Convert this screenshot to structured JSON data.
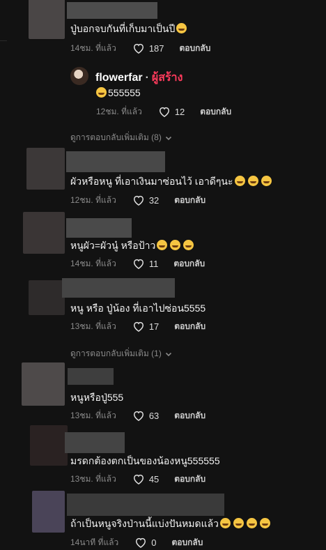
{
  "comments": [
    {
      "text": "ปู่บอกจบกันที่เก็บมาเป็นปี",
      "time": "14ชม. ที่แล้ว",
      "likes": "187",
      "reply_label": "ตอบกลับ",
      "emoji_count": 1
    },
    {
      "text": "ผัวหรือหนู ที่เอาเงินมาซ่อนไว้ เอาดีๆนะ",
      "time": "12ชม. ที่แล้ว",
      "likes": "32",
      "reply_label": "ตอบกลับ",
      "emoji_count": 3
    },
    {
      "text": "หนูผัว=ผัวนู๋ หรือป้าว",
      "time": "14ชม. ที่แล้ว",
      "likes": "11",
      "reply_label": "ตอบกลับ",
      "emoji_count": 3
    },
    {
      "text": "หนู หรือ ปู่น้อง ที่เอาไปซ่อน5555",
      "time": "13ชม. ที่แล้ว",
      "likes": "17",
      "reply_label": "ตอบกลับ",
      "emoji_count": 0
    },
    {
      "text": "หนูหรือปู่555",
      "time": "13ชม. ที่แล้ว",
      "likes": "63",
      "reply_label": "ตอบกลับ",
      "emoji_count": 0
    },
    {
      "text": "มรดกต้องตกเป็นของน้องหนู555555",
      "time": "13ชม. ที่แล้ว",
      "likes": "45",
      "reply_label": "ตอบกลับ",
      "emoji_count": 0
    },
    {
      "text": "ถ้าเป็นหนูจริงป่านนี้แบ่งปันหมดแล้ว",
      "time": "14นาที ที่แล้ว",
      "likes": "0",
      "reply_label": "ตอบกลับ",
      "emoji_count": 4
    }
  ],
  "creator_reply": {
    "username": "flowerfar",
    "dot": "·",
    "tag": "ผู้สร้าง",
    "text": "555555",
    "time": "12ชม. ที่แล้ว",
    "likes": "12",
    "reply_label": "ตอบกลับ"
  },
  "view_more_1": "ดูการตอบกลับเพิ่มเติม (8)",
  "view_more_2": "ดูการตอบกลับเพิ่มเติม (1)",
  "icons": {
    "like": "heart-outline-icon",
    "expand": "chevron-down-icon"
  }
}
